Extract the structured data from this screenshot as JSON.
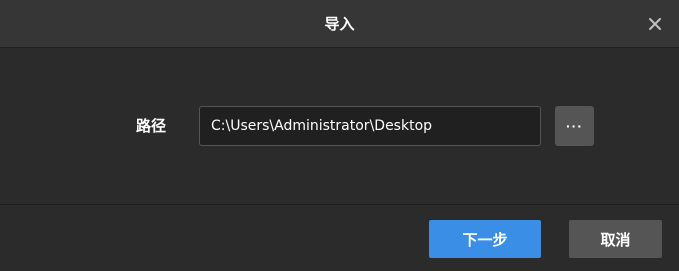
{
  "dialog": {
    "title": "导入",
    "close_icon": "close-icon"
  },
  "form": {
    "path_label": "路径",
    "path_value": "C:\\Users\\Administrator\\Desktop",
    "browse_label": "···"
  },
  "footer": {
    "next_label": "下一步",
    "cancel_label": "取消"
  },
  "colors": {
    "primary": "#3a8ee6",
    "secondary": "#555555",
    "background": "#2b2b2b",
    "titlebar": "#363636"
  }
}
